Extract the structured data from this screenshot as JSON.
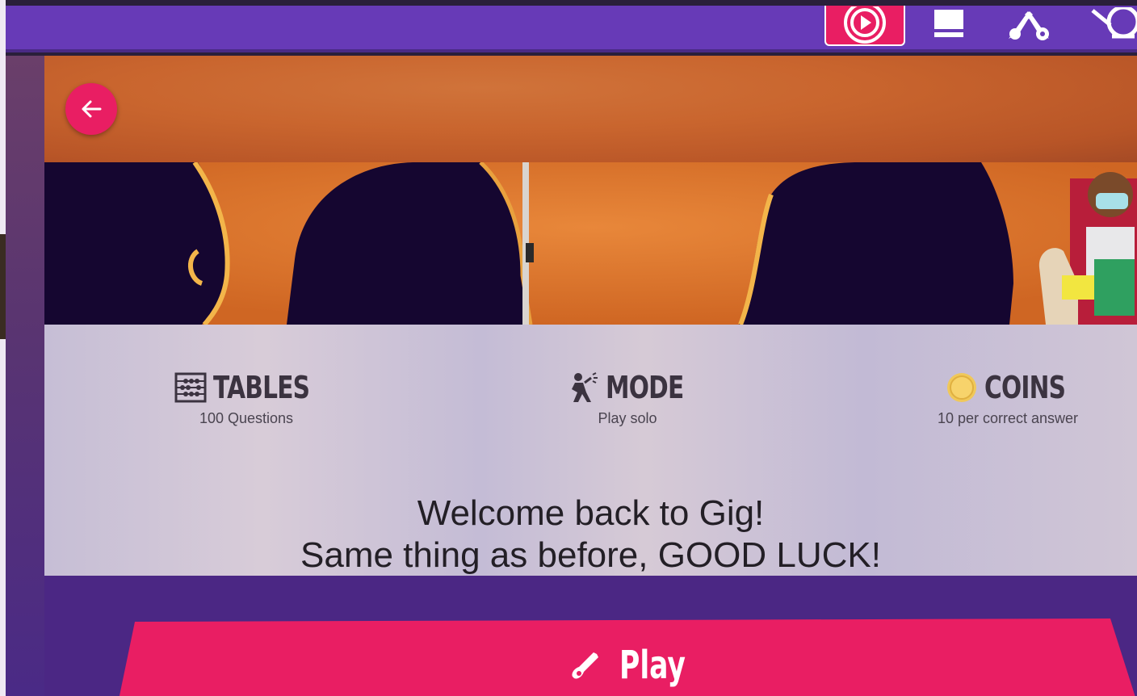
{
  "topbar": {
    "icons": [
      "play-circle-icon",
      "book-icon",
      "guitars-icon",
      "drum-icon"
    ],
    "accent": "#673ab7",
    "video_button_color": "#e91e63"
  },
  "navigation": {
    "back_icon": "arrow-left-icon"
  },
  "stats": [
    {
      "icon": "abacus-icon",
      "title": "TABLES",
      "subtitle": "100 Questions"
    },
    {
      "icon": "performer-icon",
      "title": "MODE",
      "subtitle": "Play solo"
    },
    {
      "icon": "coin-icon",
      "title": "COINS",
      "subtitle": "10 per correct answer"
    }
  ],
  "welcome": {
    "line1": "Welcome back to Gig!",
    "line2": "Same thing as before, GOOD LUCK!"
  },
  "play_button": {
    "label": "Play",
    "icon": "guitar-icon",
    "color": "#e91e63"
  }
}
